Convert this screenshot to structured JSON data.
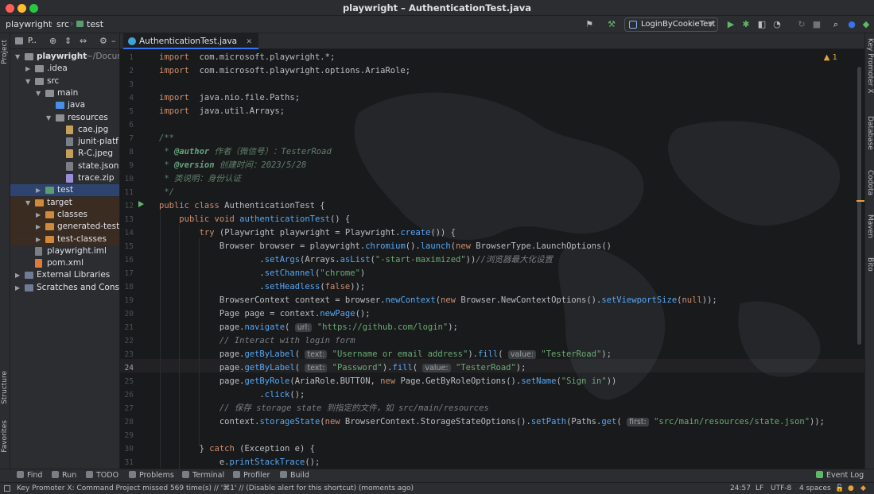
{
  "window": {
    "title": "playwright – AuthenticationTest.java"
  },
  "breadcrumb": [
    "playwright",
    "src",
    "test"
  ],
  "run_config": {
    "name": "LoginByCookieTest"
  },
  "project_panel": {
    "header": "P..",
    "tree": [
      {
        "label": "playwright",
        "suffix": "~/Docum",
        "level": 0,
        "arrow": "down",
        "icon": "folder",
        "bold": true
      },
      {
        "label": ".idea",
        "level": 1,
        "arrow": "right",
        "icon": "folder"
      },
      {
        "label": "src",
        "level": 1,
        "arrow": "down",
        "icon": "folder"
      },
      {
        "label": "main",
        "level": 2,
        "arrow": "down",
        "icon": "folder"
      },
      {
        "label": "java",
        "level": 3,
        "arrow": "",
        "icon": "folder-blue"
      },
      {
        "label": "resources",
        "level": 3,
        "arrow": "down",
        "icon": "folder"
      },
      {
        "label": "cae.jpg",
        "level": 4,
        "arrow": "",
        "icon": "file-img"
      },
      {
        "label": "junit-platf",
        "level": 4,
        "arrow": "",
        "icon": "file"
      },
      {
        "label": "R-C.jpeg",
        "level": 4,
        "arrow": "",
        "icon": "file-img"
      },
      {
        "label": "state.json",
        "level": 4,
        "arrow": "",
        "icon": "file"
      },
      {
        "label": "trace.zip",
        "level": 4,
        "arrow": "",
        "icon": "file-zip"
      },
      {
        "label": "test",
        "level": 2,
        "arrow": "right",
        "icon": "folder-green",
        "state": "selected"
      },
      {
        "label": "target",
        "level": 1,
        "arrow": "down",
        "icon": "folder-orange",
        "state": "excluded"
      },
      {
        "label": "classes",
        "level": 2,
        "arrow": "right",
        "icon": "folder-orange",
        "state": "excluded"
      },
      {
        "label": "generated-test-",
        "level": 2,
        "arrow": "right",
        "icon": "folder-orange",
        "state": "excluded"
      },
      {
        "label": "test-classes",
        "level": 2,
        "arrow": "right",
        "icon": "folder-orange",
        "state": "excluded"
      },
      {
        "label": "playwright.iml",
        "level": 1,
        "arrow": "",
        "icon": "file"
      },
      {
        "label": "pom.xml",
        "level": 1,
        "arrow": "",
        "icon": "file-xml"
      },
      {
        "label": "External Libraries",
        "level": 0,
        "arrow": "right",
        "icon": "lib"
      },
      {
        "label": "Scratches and Consol",
        "level": 0,
        "arrow": "right",
        "icon": "lib"
      }
    ]
  },
  "left_strip": {
    "top_label": "Project",
    "structure_label": "Structure",
    "favorites_label": "Favorites"
  },
  "right_strip": [
    "Key Promoter X",
    "Database",
    "Codota",
    "Maven",
    "Bito"
  ],
  "editor": {
    "tab": "AuthenticationTest.java",
    "warnings": "1",
    "current_line": 24,
    "lines": [
      {
        "n": 1,
        "parts": [
          [
            "kw",
            "import"
          ],
          [
            "",
            "  com.microsoft.playwright.*;"
          ]
        ]
      },
      {
        "n": 2,
        "parts": [
          [
            "kw",
            "import"
          ],
          [
            "",
            "  com.microsoft.playwright.options.AriaRole;"
          ]
        ]
      },
      {
        "n": 3,
        "parts": []
      },
      {
        "n": 4,
        "parts": [
          [
            "kw",
            "import"
          ],
          [
            "",
            "  java.nio.file.Paths;"
          ]
        ]
      },
      {
        "n": 5,
        "parts": [
          [
            "kw",
            "import"
          ],
          [
            "",
            "  java.util.Arrays;"
          ]
        ]
      },
      {
        "n": 6,
        "parts": []
      },
      {
        "n": 7,
        "parts": [
          [
            "doc",
            "/**"
          ]
        ]
      },
      {
        "n": 8,
        "parts": [
          [
            "doc",
            " * "
          ],
          [
            "tag",
            "@author"
          ],
          [
            "doc",
            " 作者（微信号）：TesterRoad"
          ]
        ]
      },
      {
        "n": 9,
        "parts": [
          [
            "doc",
            " * "
          ],
          [
            "tag",
            "@version"
          ],
          [
            "doc",
            " 创建时间：2023/5/28"
          ]
        ]
      },
      {
        "n": 10,
        "parts": [
          [
            "doc",
            " * 类说明：身份认证"
          ]
        ]
      },
      {
        "n": 11,
        "parts": [
          [
            "doc",
            " */"
          ]
        ]
      },
      {
        "n": 12,
        "parts": [
          [
            "kw",
            "public class"
          ],
          [
            "",
            " AuthenticationTest {"
          ]
        ]
      },
      {
        "n": 13,
        "parts": [
          [
            "",
            "    "
          ],
          [
            "kw",
            "public void"
          ],
          [
            "",
            " "
          ],
          [
            "fn",
            "authenticationTest"
          ],
          [
            "",
            "() {"
          ]
        ]
      },
      {
        "n": 14,
        "parts": [
          [
            "",
            "        "
          ],
          [
            "kw",
            "try"
          ],
          [
            "",
            " (Playwright playwright = Playwright."
          ],
          [
            "fn",
            "create"
          ],
          [
            "",
            "()) {"
          ]
        ]
      },
      {
        "n": 15,
        "parts": [
          [
            "",
            "            Browser browser = playwright."
          ],
          [
            "fn",
            "chromium"
          ],
          [
            "",
            "()."
          ],
          [
            "fn",
            "launch"
          ],
          [
            "",
            "("
          ],
          [
            "kw",
            "new"
          ],
          [
            "",
            " BrowserType.LaunchOptions()"
          ]
        ]
      },
      {
        "n": 16,
        "parts": [
          [
            "",
            "                    ."
          ],
          [
            "fn",
            "setArgs"
          ],
          [
            "",
            "(Arrays."
          ],
          [
            "fn",
            "asList"
          ],
          [
            "",
            "("
          ],
          [
            "str",
            "\"-start-maximized\""
          ],
          [
            "",
            "))"
          ],
          [
            "cm",
            "//浏览器最大化设置"
          ]
        ]
      },
      {
        "n": 17,
        "parts": [
          [
            "",
            "                    ."
          ],
          [
            "fn",
            "setChannel"
          ],
          [
            "",
            "("
          ],
          [
            "str",
            "\"chrome\""
          ],
          [
            "",
            ")"
          ]
        ]
      },
      {
        "n": 18,
        "parts": [
          [
            "",
            "                    ."
          ],
          [
            "fn",
            "setHeadless"
          ],
          [
            "",
            "("
          ],
          [
            "kw",
            "false"
          ],
          [
            "",
            "));"
          ]
        ]
      },
      {
        "n": 19,
        "parts": [
          [
            "",
            "            BrowserContext context = browser."
          ],
          [
            "fn",
            "newContext"
          ],
          [
            "",
            "("
          ],
          [
            "kw",
            "new"
          ],
          [
            "",
            " Browser.NewContextOptions()."
          ],
          [
            "fn",
            "setViewportSize"
          ],
          [
            "",
            "("
          ],
          [
            "kw",
            "null"
          ],
          [
            "",
            "));"
          ]
        ]
      },
      {
        "n": 20,
        "parts": [
          [
            "",
            "            Page page = context."
          ],
          [
            "fn",
            "newPage"
          ],
          [
            "",
            "();"
          ]
        ]
      },
      {
        "n": 21,
        "parts": [
          [
            "",
            "            page."
          ],
          [
            "fn",
            "navigate"
          ],
          [
            "",
            "( "
          ],
          [
            "hint",
            "url:"
          ],
          [
            "",
            " "
          ],
          [
            "str",
            "\"https://github.com/login\""
          ],
          [
            "",
            ");"
          ]
        ]
      },
      {
        "n": 22,
        "parts": [
          [
            "",
            "            "
          ],
          [
            "cm",
            "// Interact with login form"
          ]
        ]
      },
      {
        "n": 23,
        "parts": [
          [
            "",
            "            page."
          ],
          [
            "fn",
            "getByLabel"
          ],
          [
            "",
            "( "
          ],
          [
            "hint",
            "text:"
          ],
          [
            "",
            " "
          ],
          [
            "str",
            "\"Username or email address\""
          ],
          [
            "",
            ")."
          ],
          [
            "fn",
            "fill"
          ],
          [
            "",
            "( "
          ],
          [
            "hint",
            "value:"
          ],
          [
            "",
            " "
          ],
          [
            "str",
            "\"TesterRoad\""
          ],
          [
            "",
            ");"
          ]
        ]
      },
      {
        "n": 24,
        "parts": [
          [
            "",
            "            page."
          ],
          [
            "fn",
            "getByLabel"
          ],
          [
            "",
            "( "
          ],
          [
            "hint",
            "text:"
          ],
          [
            "",
            " "
          ],
          [
            "str",
            "\"Password\""
          ],
          [
            "",
            ")."
          ],
          [
            "fn",
            "fill"
          ],
          [
            "",
            "( "
          ],
          [
            "hint",
            "value:"
          ],
          [
            "",
            " "
          ],
          [
            "str",
            "\"TesterRoad\""
          ],
          [
            "",
            ");"
          ]
        ]
      },
      {
        "n": 25,
        "parts": [
          [
            "",
            "            page."
          ],
          [
            "fn",
            "getByRole"
          ],
          [
            "",
            "(AriaRole.BUTTON, "
          ],
          [
            "kw",
            "new"
          ],
          [
            "",
            " Page.GetByRoleOptions()."
          ],
          [
            "fn",
            "setName"
          ],
          [
            "",
            "("
          ],
          [
            "str",
            "\"Sign in\""
          ],
          [
            "",
            "))"
          ]
        ]
      },
      {
        "n": 26,
        "parts": [
          [
            "",
            "                    ."
          ],
          [
            "fn",
            "click"
          ],
          [
            "",
            "();"
          ]
        ]
      },
      {
        "n": 27,
        "parts": [
          [
            "",
            "            "
          ],
          [
            "cm",
            "// 保存 storage state 到指定的文件，如 src/main/resources"
          ]
        ]
      },
      {
        "n": 28,
        "parts": [
          [
            "",
            "            context."
          ],
          [
            "fn",
            "storageState"
          ],
          [
            "",
            "("
          ],
          [
            "kw",
            "new"
          ],
          [
            "",
            " BrowserContext.StorageStateOptions()."
          ],
          [
            "fn",
            "setPath"
          ],
          [
            "",
            "(Paths."
          ],
          [
            "fn",
            "get"
          ],
          [
            "",
            "( "
          ],
          [
            "hint",
            "first:"
          ],
          [
            "",
            " "
          ],
          [
            "str",
            "\"src/main/resources/state.json\""
          ],
          [
            "",
            "));"
          ]
        ]
      },
      {
        "n": 29,
        "parts": []
      },
      {
        "n": 30,
        "parts": [
          [
            "",
            "        } "
          ],
          [
            "kw",
            "catch"
          ],
          [
            "",
            " (Exception e) {"
          ]
        ]
      },
      {
        "n": 31,
        "parts": [
          [
            "",
            "            e."
          ],
          [
            "fn",
            "printStackTrace"
          ],
          [
            "",
            "();"
          ]
        ]
      }
    ]
  },
  "bottom_tools": [
    {
      "label": "Find",
      "icon": "search-icon"
    },
    {
      "label": "Run",
      "icon": "run-icon"
    },
    {
      "label": "TODO",
      "icon": "todo-icon"
    },
    {
      "label": "Problems",
      "icon": "problems-icon"
    },
    {
      "label": "Terminal",
      "icon": "terminal-icon"
    },
    {
      "label": "Profiler",
      "icon": "profiler-icon"
    },
    {
      "label": "Build",
      "icon": "build-icon"
    }
  ],
  "event_log": "Event Log",
  "status": {
    "message": "Key Promoter X: Command Project missed 569 time(s) // '⌘1' // (Disable alert for this shortcut) (moments ago)",
    "position": "24:57",
    "line_sep": "LF",
    "encoding": "UTF-8",
    "indent": "4 spaces"
  },
  "colors": {
    "accent": "#3574f0",
    "keyword": "#cf8e6d",
    "string": "#6aab73",
    "function": "#56a8f5",
    "comment": "#7a7e85"
  }
}
